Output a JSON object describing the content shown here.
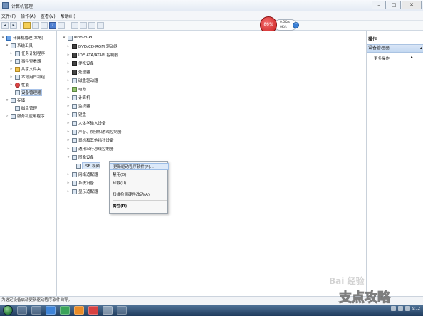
{
  "window": {
    "title": "计算机管理",
    "controls": [
      "–",
      "□",
      "✕"
    ]
  },
  "menu": [
    "文件(F)",
    "操作(A)",
    "查看(V)",
    "帮助(H)"
  ],
  "left_tree": [
    {
      "label": "计算机管理(本地)",
      "icon": "computer-management-icon",
      "level": 0,
      "exp": "▾"
    },
    {
      "label": "系统工具",
      "icon": "tools-icon",
      "level": 1,
      "exp": "▾"
    },
    {
      "label": "任务计划程序",
      "icon": "task-scheduler-icon",
      "level": 2,
      "exp": "▹"
    },
    {
      "label": "事件查看器",
      "icon": "event-viewer-icon",
      "level": 2,
      "exp": "▹"
    },
    {
      "label": "共享文件夹",
      "icon": "shared-folder-icon",
      "level": 2,
      "exp": "▹"
    },
    {
      "label": "本地用户和组",
      "icon": "users-icon",
      "level": 2,
      "exp": "▹"
    },
    {
      "label": "性能",
      "icon": "performance-icon",
      "level": 2,
      "exp": "▹"
    },
    {
      "label": "设备管理器",
      "icon": "device-manager-icon",
      "level": 2,
      "exp": "",
      "selected": true
    },
    {
      "label": "存储",
      "icon": "storage-icon",
      "level": 1,
      "exp": "▾"
    },
    {
      "label": "磁盘管理",
      "icon": "disk-icon",
      "level": 2,
      "exp": ""
    },
    {
      "label": "服务和应用程序",
      "icon": "services-icon",
      "level": 1,
      "exp": "▹"
    }
  ],
  "device_tree": [
    {
      "label": "lenovo-PC",
      "icon": "computer-icon",
      "level": 0,
      "exp": "▾"
    },
    {
      "label": "DVD/CD-ROM 驱动器",
      "icon": "dvd-drive-icon",
      "level": 1,
      "exp": "▹"
    },
    {
      "label": "IDE ATA/ATAPI 控制器",
      "icon": "ide-controller-icon",
      "level": 1,
      "exp": "▹"
    },
    {
      "label": "便携设备",
      "icon": "portable-device-icon",
      "level": 1,
      "exp": "▹"
    },
    {
      "label": "处理器",
      "icon": "processor-icon",
      "level": 1,
      "exp": "▹"
    },
    {
      "label": "磁盘驱动器",
      "icon": "disk-drive-icon",
      "level": 1,
      "exp": "▹"
    },
    {
      "label": "电池",
      "icon": "battery-icon",
      "level": 1,
      "exp": "▹"
    },
    {
      "label": "计算机",
      "icon": "computer-icon",
      "level": 1,
      "exp": "▹"
    },
    {
      "label": "监视器",
      "icon": "monitor-icon",
      "level": 1,
      "exp": "▹"
    },
    {
      "label": "键盘",
      "icon": "keyboard-icon",
      "level": 1,
      "exp": "▹"
    },
    {
      "label": "人体学输入设备",
      "icon": "hid-icon",
      "level": 1,
      "exp": "▹"
    },
    {
      "label": "声音、视频和游戏控制器",
      "icon": "sound-icon",
      "level": 1,
      "exp": "▹"
    },
    {
      "label": "鼠标和其他指针设备",
      "icon": "mouse-icon",
      "level": 1,
      "exp": "▹"
    },
    {
      "label": "通用串行总线控制器",
      "icon": "usb-controller-icon",
      "level": 1,
      "exp": "▹"
    },
    {
      "label": "图像设备",
      "icon": "imaging-device-icon",
      "level": 1,
      "exp": "▾"
    },
    {
      "label": "USB 视频",
      "icon": "webcam-icon",
      "level": 2,
      "exp": ""
    },
    {
      "label": "网络适配器",
      "icon": "network-adapter-icon",
      "level": 1,
      "exp": "▹"
    },
    {
      "label": "系统设备",
      "icon": "system-device-icon",
      "level": 1,
      "exp": "▹"
    },
    {
      "label": "显示适配器",
      "icon": "display-adapter-icon",
      "level": 1,
      "exp": "▹"
    }
  ],
  "context_menu": {
    "items": [
      "更新驱动程序软件(P)...",
      "禁用(D)",
      "卸载(U)",
      "扫描检测硬件改动(A)",
      "属性(R)"
    ]
  },
  "actions": {
    "header": "操作",
    "main": "设备管理器",
    "sub": "更多操作"
  },
  "status_bar": "为选定设备启动更新驱动程序软件向导。",
  "speed_widget": {
    "percent": "86%",
    "down": "0.5K/s",
    "up": "0K/s"
  },
  "taskbar": {
    "clock": "9:12"
  },
  "watermark": {
    "baidu": "Bai 经验",
    "site": "支点攻略"
  }
}
